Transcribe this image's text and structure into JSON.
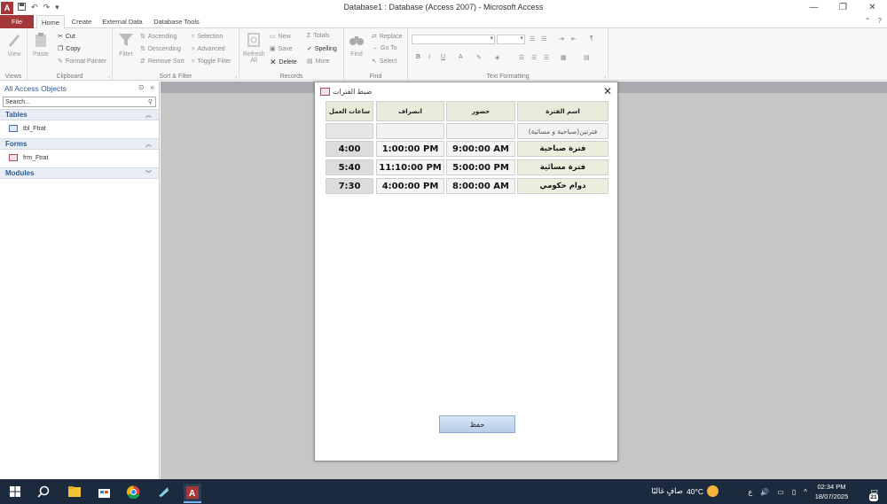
{
  "window": {
    "title": "Database1 : Database (Access 2007) - Microsoft Access",
    "app_icon_letter": "A",
    "qat_icons": [
      "save-icon",
      "undo-icon",
      "redo-icon",
      "customize-qat-icon"
    ],
    "controls": {
      "minimize": "—",
      "restore": "❐",
      "close": "✕"
    }
  },
  "tabs": {
    "file": "File",
    "home": "Home",
    "create": "Create",
    "external": "External Data",
    "dbtools": "Database Tools",
    "right_icons": [
      "help-icon",
      "ribbon-collapse-icon"
    ]
  },
  "ribbon": {
    "views": {
      "label": "Views",
      "view": "View"
    },
    "clipboard": {
      "label": "Clipboard",
      "paste": "Paste",
      "cut": "Cut",
      "copy": "Copy",
      "format_painter": "Format Painter"
    },
    "sort_filter": {
      "label": "Sort & Filter",
      "filter": "Filter",
      "ascending": "Ascending",
      "descending": "Descending",
      "remove_sort": "Remove Sort",
      "selection": "Selection",
      "advanced": "Advanced",
      "toggle_filter": "Toggle Filter"
    },
    "records": {
      "label": "Records",
      "refresh": "Refresh",
      "refresh_all": "All",
      "new": "New",
      "save": "Save",
      "delete": "Delete",
      "totals": "Totals",
      "spelling": "Spelling",
      "more": "More"
    },
    "find": {
      "label": "Find",
      "find": "Find",
      "replace": "Replace",
      "goto": "Go To",
      "select": "Select"
    },
    "text_formatting": {
      "label": "Text Formatting",
      "bold": "B",
      "italic": "I",
      "underline": "U",
      "font_color": "A"
    }
  },
  "nav": {
    "title": "All Access Objects",
    "search_placeholder": "Search...",
    "groups": [
      {
        "label": "Tables",
        "items": [
          "tbl_Ftrat"
        ]
      },
      {
        "label": "Forms",
        "items": [
          "frm_Ftrat"
        ]
      },
      {
        "label": "Modules",
        "items": []
      }
    ]
  },
  "form": {
    "title": "ضبط الفترات",
    "close": "✕",
    "headers": {
      "period": "اسم الفترة",
      "attend": "حضور",
      "leave": "انصراف",
      "hours": "ساعات العمل"
    },
    "placeholder_row": {
      "period": "فترتين(صباحية و مسائية)",
      "attend": "",
      "leave": "",
      "hours": ""
    },
    "rows": [
      {
        "period": "فترة صباحية",
        "attend": "9:00:00 AM",
        "leave": "1:00:00 PM",
        "hours": "4:00"
      },
      {
        "period": "فترة مسائية",
        "attend": "5:00:00 PM",
        "leave": "11:10:00 PM",
        "hours": "5:40"
      },
      {
        "period": "دوام حكومي",
        "attend": "8:00:00 AM",
        "leave": "4:00:00 PM",
        "hours": "7:30"
      }
    ],
    "save_button": "حفظ"
  },
  "taskbar": {
    "start_icon": "windows-start-icon",
    "weather_temp": "40°C",
    "weather_text": "صافٍ غالبًا",
    "lang": "ع",
    "time": "02:34 PM",
    "date": "18/07/2025",
    "notifications": "21"
  },
  "colors": {
    "access_red": "#a4373a",
    "header_green": "#e7ecda",
    "taskbar": "#1b2a3c",
    "workspace": "#c6c6c6"
  }
}
